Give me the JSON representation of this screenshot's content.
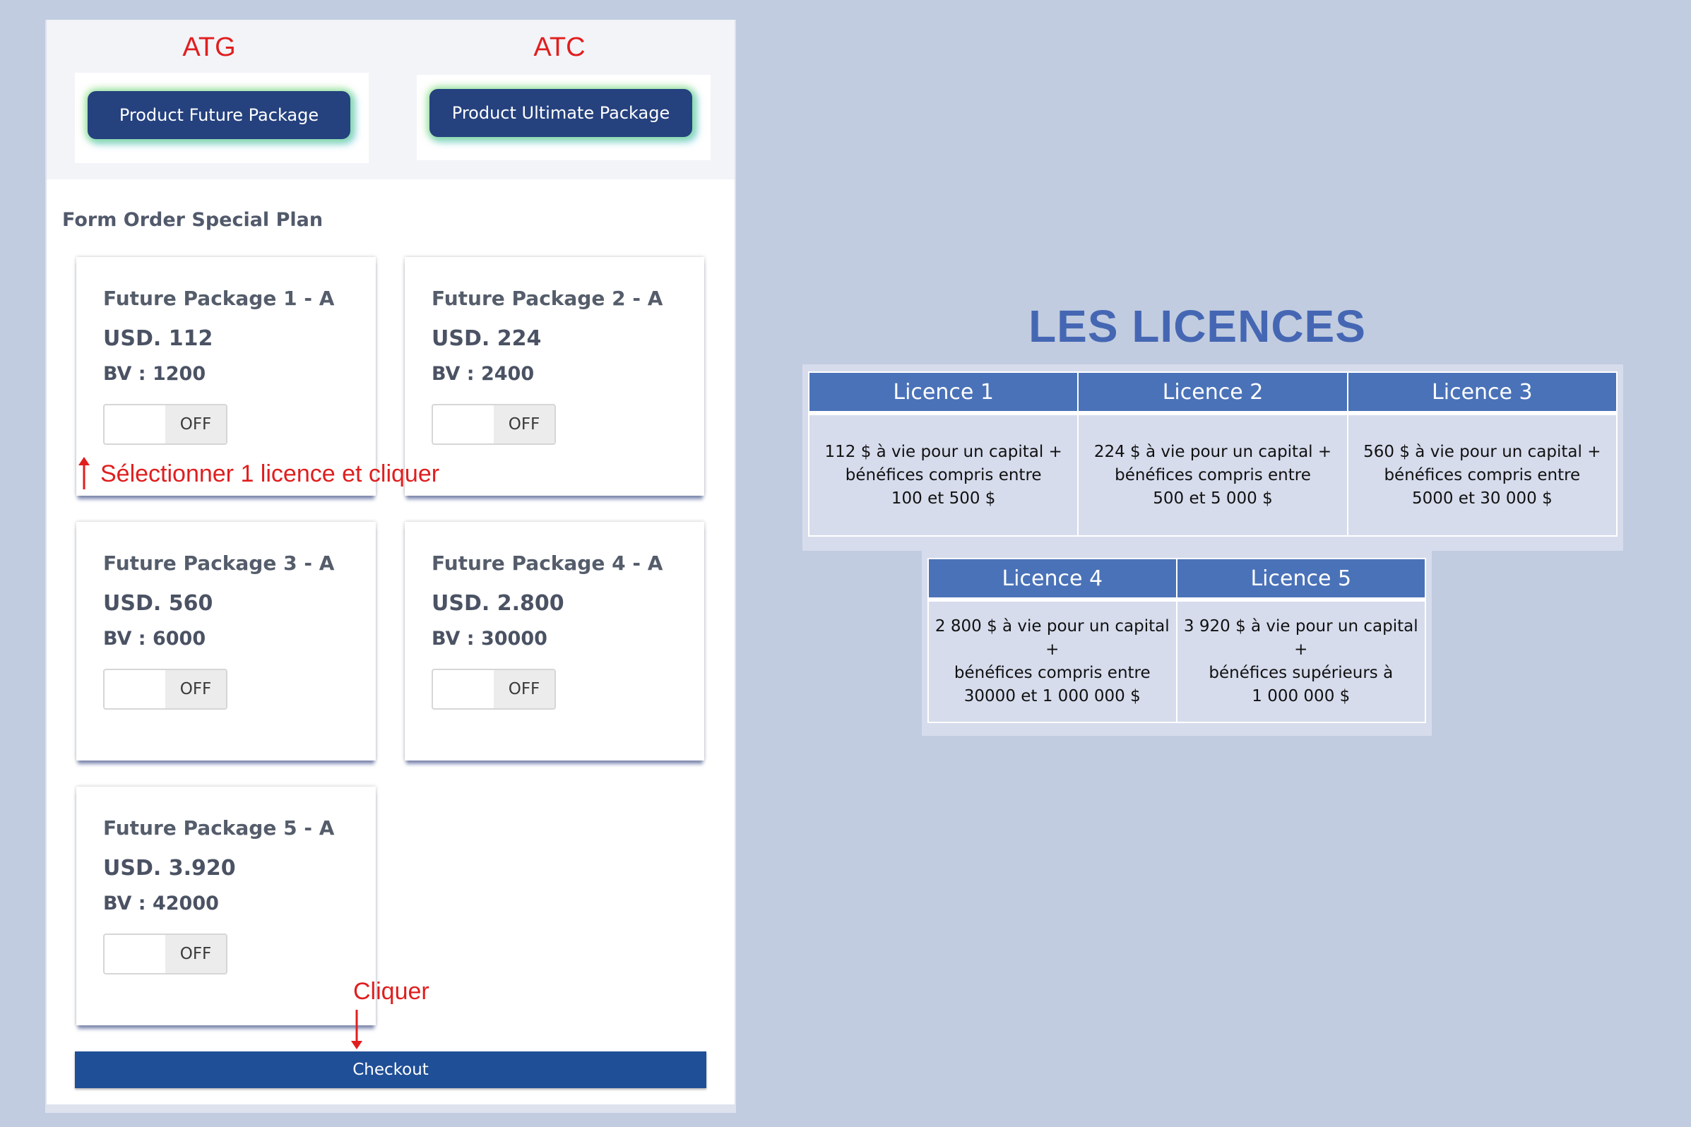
{
  "tags": {
    "atg": "ATG",
    "atc": "ATC"
  },
  "package_buttons": {
    "future": "Product Future Package",
    "ultimate": "Product Ultimate Package"
  },
  "form": {
    "title": "Form Order Special Plan",
    "cards": [
      {
        "title": "Future Package 1 - A",
        "price": "USD. 112",
        "bv": "BV : 1200",
        "toggle": "OFF"
      },
      {
        "title": "Future Package 2 - A",
        "price": "USD. 224",
        "bv": "BV : 2400",
        "toggle": "OFF"
      },
      {
        "title": "Future Package 3 - A",
        "price": "USD. 560",
        "bv": "BV : 6000",
        "toggle": "OFF"
      },
      {
        "title": "Future Package 4 - A",
        "price": "USD. 2.800",
        "bv": "BV : 30000",
        "toggle": "OFF"
      },
      {
        "title": "Future Package 5 - A",
        "price": "USD. 3.920",
        "bv": "BV : 42000",
        "toggle": "OFF"
      }
    ],
    "checkout_label": "Checkout"
  },
  "annotations": {
    "select": "Sélectionner 1 licence et cliquer",
    "click": "Cliquer"
  },
  "licences": {
    "title": "LES LICENCES",
    "items": [
      {
        "name": "Licence 1",
        "lines": [
          "112 $ à vie pour un capital +",
          "bénéfices compris entre",
          "100 et 500 $"
        ]
      },
      {
        "name": "Licence 2",
        "lines": [
          "224 $ à vie pour un capital +",
          "bénéfices compris entre",
          "500 et 5 000 $"
        ]
      },
      {
        "name": "Licence 3",
        "lines": [
          "560 $ à vie pour un capital +",
          "bénéfices compris entre",
          "5000 et 30 000 $"
        ]
      },
      {
        "name": "Licence 4",
        "lines": [
          "2 800 $ à vie pour un capital +",
          "bénéfices compris entre",
          "30000 et 1 000 000 $"
        ]
      },
      {
        "name": "Licence 5",
        "lines": [
          "3 920 $ à vie pour un capital +",
          "bénéfices supérieurs à",
          "1 000 000 $"
        ]
      }
    ]
  },
  "colors": {
    "background": "#c1cce0",
    "accent_red": "#e01e1e",
    "button_navy": "#25417e",
    "table_header": "#4a72b8",
    "title_blue": "#4567b3"
  }
}
